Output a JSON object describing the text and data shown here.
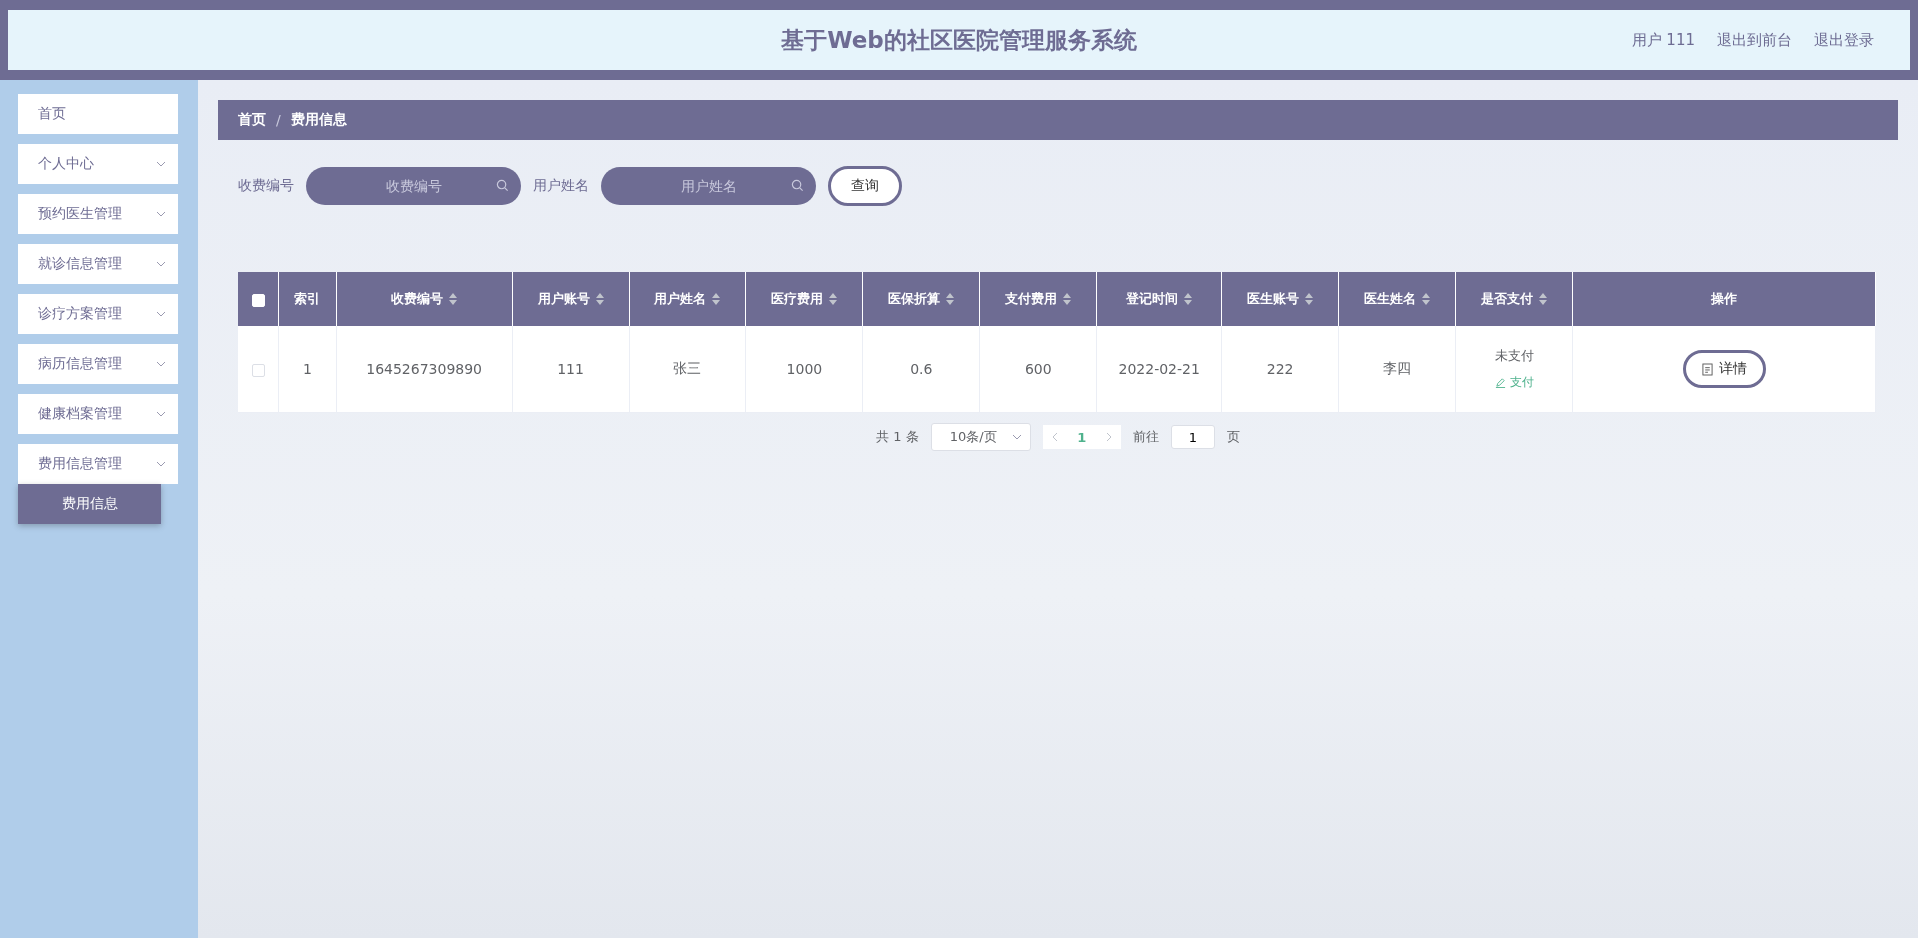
{
  "header": {
    "title": "基于Web的社区医院管理服务系统",
    "links": [
      "用户 111",
      "退出到前台",
      "退出登录"
    ]
  },
  "sidebar": {
    "items": [
      {
        "label": "首页",
        "has_arrow": false
      },
      {
        "label": "个人中心",
        "has_arrow": true
      },
      {
        "label": "预约医生管理",
        "has_arrow": true
      },
      {
        "label": "就诊信息管理",
        "has_arrow": true
      },
      {
        "label": "诊疗方案管理",
        "has_arrow": true
      },
      {
        "label": "病历信息管理",
        "has_arrow": true
      },
      {
        "label": "健康档案管理",
        "has_arrow": true
      },
      {
        "label": "费用信息管理",
        "has_arrow": true,
        "expanded": true,
        "children": [
          {
            "label": "费用信息",
            "selected": true
          }
        ]
      }
    ]
  },
  "breadcrumb": [
    "首页",
    "/",
    "费用信息"
  ],
  "search": {
    "fields": [
      {
        "label": "收费编号",
        "placeholder": "收费编号"
      },
      {
        "label": "用户姓名",
        "placeholder": "用户姓名"
      }
    ],
    "button": "查询"
  },
  "table": {
    "select_all_checked": false,
    "columns": [
      {
        "label": "索引",
        "sortable": false
      },
      {
        "label": "收费编号",
        "sortable": true
      },
      {
        "label": "用户账号",
        "sortable": true
      },
      {
        "label": "用户姓名",
        "sortable": true
      },
      {
        "label": "医疗费用",
        "sortable": true
      },
      {
        "label": "医保折算",
        "sortable": true
      },
      {
        "label": "支付费用",
        "sortable": true
      },
      {
        "label": "登记时间",
        "sortable": true
      },
      {
        "label": "医生账号",
        "sortable": true
      },
      {
        "label": "医生姓名",
        "sortable": true
      },
      {
        "label": "是否支付",
        "sortable": true
      },
      {
        "label": "操作",
        "sortable": false
      }
    ],
    "rows": [
      {
        "checked": false,
        "cells": [
          "1",
          "1645267309890",
          "111",
          "张三",
          "1000",
          "0.6",
          "600",
          "2022-02-21",
          "222",
          "李四"
        ],
        "pay_status": "未支付",
        "pay_action": "支付",
        "detail_button": "详情"
      }
    ]
  },
  "pagination": {
    "total": "共 1 条",
    "page_size": "10条/页",
    "pages": [
      {
        "label": "1",
        "selected": true
      }
    ],
    "goto_label": "前往",
    "goto_value": "1",
    "goto_suffix": "页"
  }
}
